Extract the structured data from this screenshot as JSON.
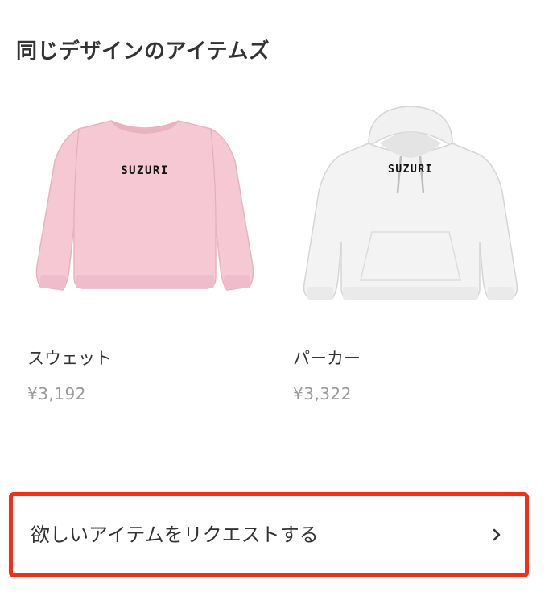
{
  "section": {
    "title": "同じデザインのアイテムズ"
  },
  "products": [
    {
      "name": "スウェット",
      "price": "¥3,192",
      "print_text": "SUZURI",
      "color": "#f6c8d3",
      "icon": "sweatshirt-image"
    },
    {
      "name": "パーカー",
      "price": "¥3,322",
      "print_text": "SUZURI",
      "color": "#f3f3f3",
      "icon": "hoodie-image"
    }
  ],
  "request": {
    "label": "欲しいアイテムをリクエストする",
    "icon": "chevron-right-icon"
  },
  "colors": {
    "highlight_border": "#ff2a12",
    "divider": "#dddddd",
    "price_text": "#9a9a9a"
  }
}
